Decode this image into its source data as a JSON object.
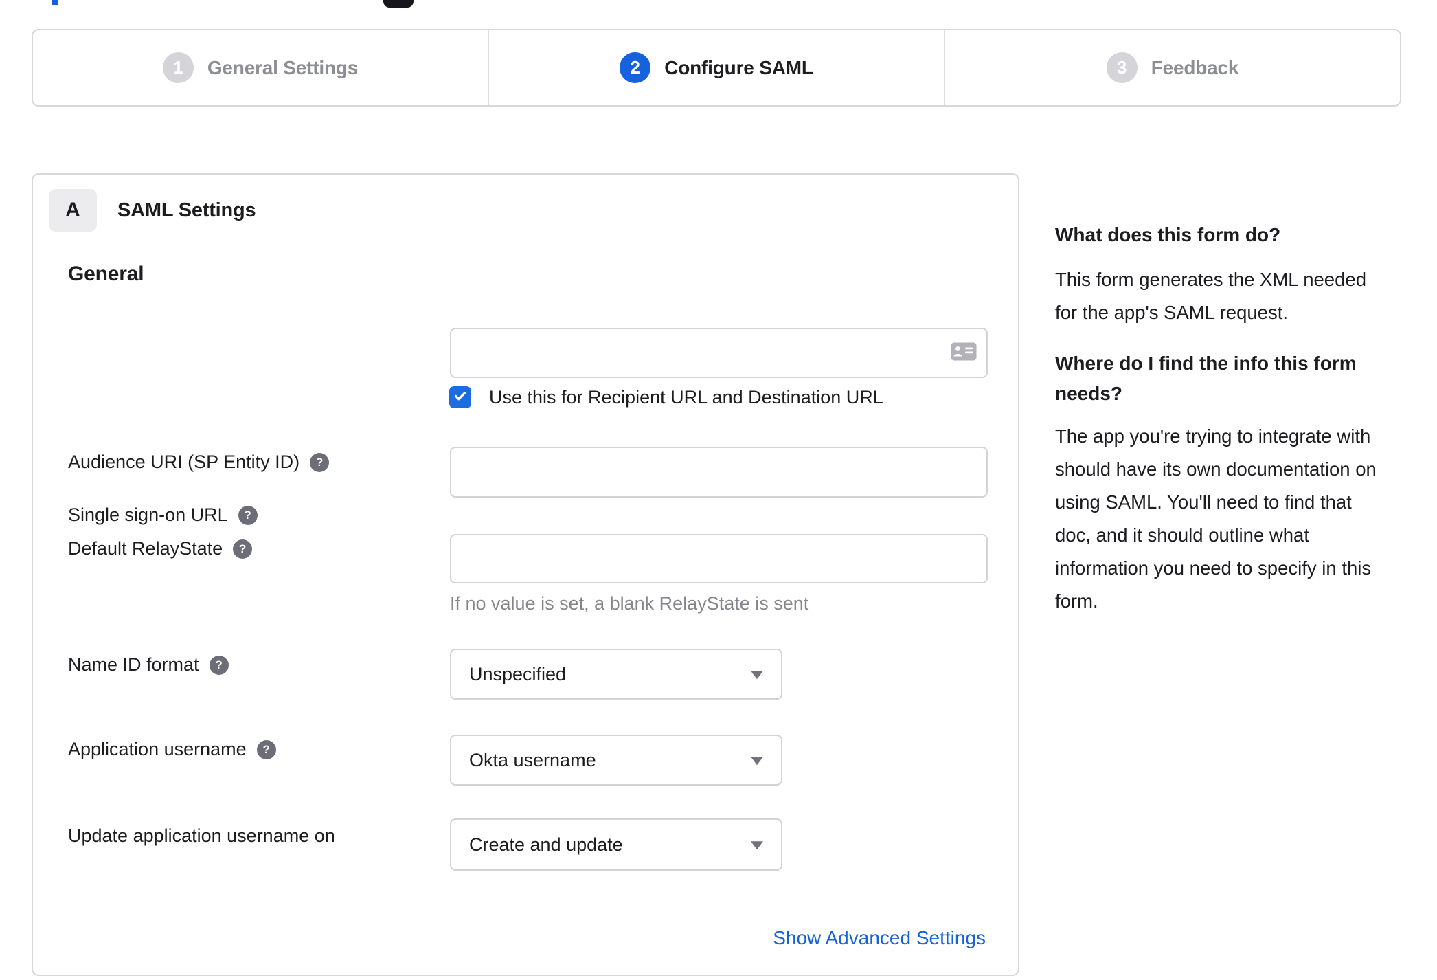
{
  "colors": {
    "accent": "#1662dd",
    "checkbox": "#1b6ce1",
    "inactive": "#d4d4d9",
    "muted": "#8d8d95"
  },
  "stepper": {
    "steps": [
      {
        "number": "1",
        "label": "General Settings"
      },
      {
        "number": "2",
        "label": "Configure SAML"
      },
      {
        "number": "3",
        "label": "Feedback"
      }
    ]
  },
  "panel": {
    "badge": "A",
    "title": "SAML Settings",
    "section": "General",
    "help_glyph": "?",
    "sso": {
      "label": "Single sign-on URL",
      "value": "",
      "checkbox_label": "Use this for Recipient URL and Destination URL"
    },
    "audience": {
      "label": "Audience URI (SP Entity ID)",
      "value": ""
    },
    "relay": {
      "label": "Default RelayState",
      "value": "",
      "hint": "If no value is set, a blank RelayState is sent"
    },
    "name_id": {
      "label": "Name ID format",
      "value": "Unspecified"
    },
    "app_username": {
      "label": "Application username",
      "value": "Okta username"
    },
    "update_username": {
      "label": "Update application username on",
      "value": "Create and update"
    },
    "advanced_link": "Show Advanced Settings"
  },
  "sidebar": {
    "q1": "What does this form do?",
    "p1_lines": [
      "This form generates the XML needed",
      "for the app's SAML request."
    ],
    "q2_lines": [
      "Where do I find the info this form",
      "needs?"
    ],
    "p2_lines": [
      "The app you're trying to integrate with",
      "should have its own documentation on",
      "using SAML. You'll need to find that",
      "doc, and it should outline what",
      "information you need to specify in this",
      "form."
    ]
  }
}
